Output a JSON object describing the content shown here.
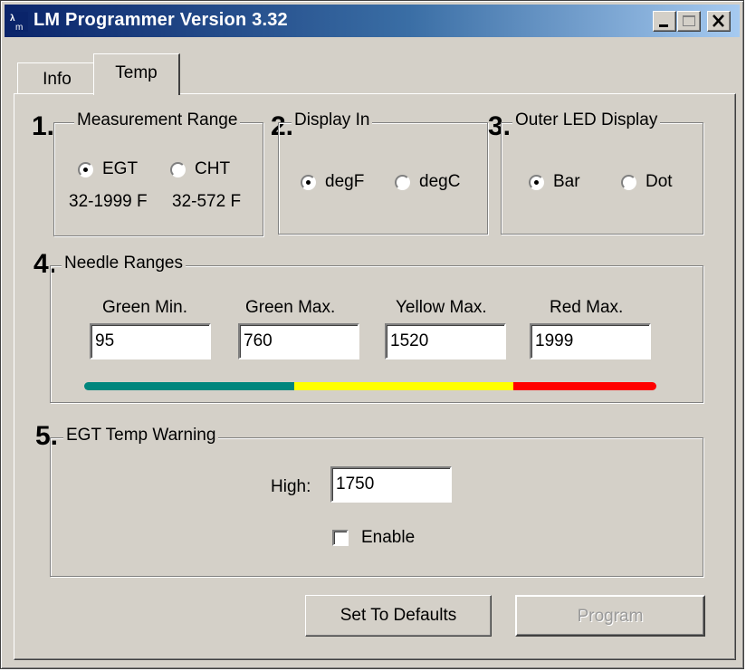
{
  "window": {
    "title": "LM Programmer Version 3.32",
    "icon": "app-icon",
    "controls": [
      "minimize-icon",
      "maximize-icon",
      "close-icon"
    ]
  },
  "tabs": [
    {
      "label": "Info",
      "active": false
    },
    {
      "label": "Temp",
      "active": true
    }
  ],
  "measurement_range": {
    "number": "1.",
    "legend": "Measurement Range",
    "options": [
      {
        "label": "EGT",
        "range": "32-1999 F",
        "selected": true
      },
      {
        "label": "CHT",
        "range": "32-572 F",
        "selected": false
      }
    ]
  },
  "display_in": {
    "number": "2.",
    "legend": "Display In",
    "options": [
      {
        "label": "degF",
        "selected": true
      },
      {
        "label": "degC",
        "selected": false
      }
    ]
  },
  "outer_led": {
    "number": "3.",
    "legend": "Outer LED Display",
    "options": [
      {
        "label": "Bar",
        "selected": true
      },
      {
        "label": "Dot",
        "selected": false
      }
    ]
  },
  "needle_ranges": {
    "number": "4.",
    "legend": "Needle Ranges",
    "fields": [
      {
        "label": "Green Min.",
        "value": "95"
      },
      {
        "label": "Green Max.",
        "value": "760"
      },
      {
        "label": "Yellow Max.",
        "value": "1520"
      },
      {
        "label": "Red Max.",
        "value": "1999"
      }
    ],
    "bar_colors": {
      "green": "#00867d",
      "yellow": "#ffff00",
      "red": "#ff0000"
    }
  },
  "egt_warning": {
    "number": "5.",
    "legend": "EGT Temp Warning",
    "high_label": "High:",
    "high_value": "1750",
    "enable_label": "Enable",
    "enabled": false
  },
  "buttons": {
    "defaults": "Set To Defaults",
    "program": "Program",
    "program_enabled": false
  }
}
